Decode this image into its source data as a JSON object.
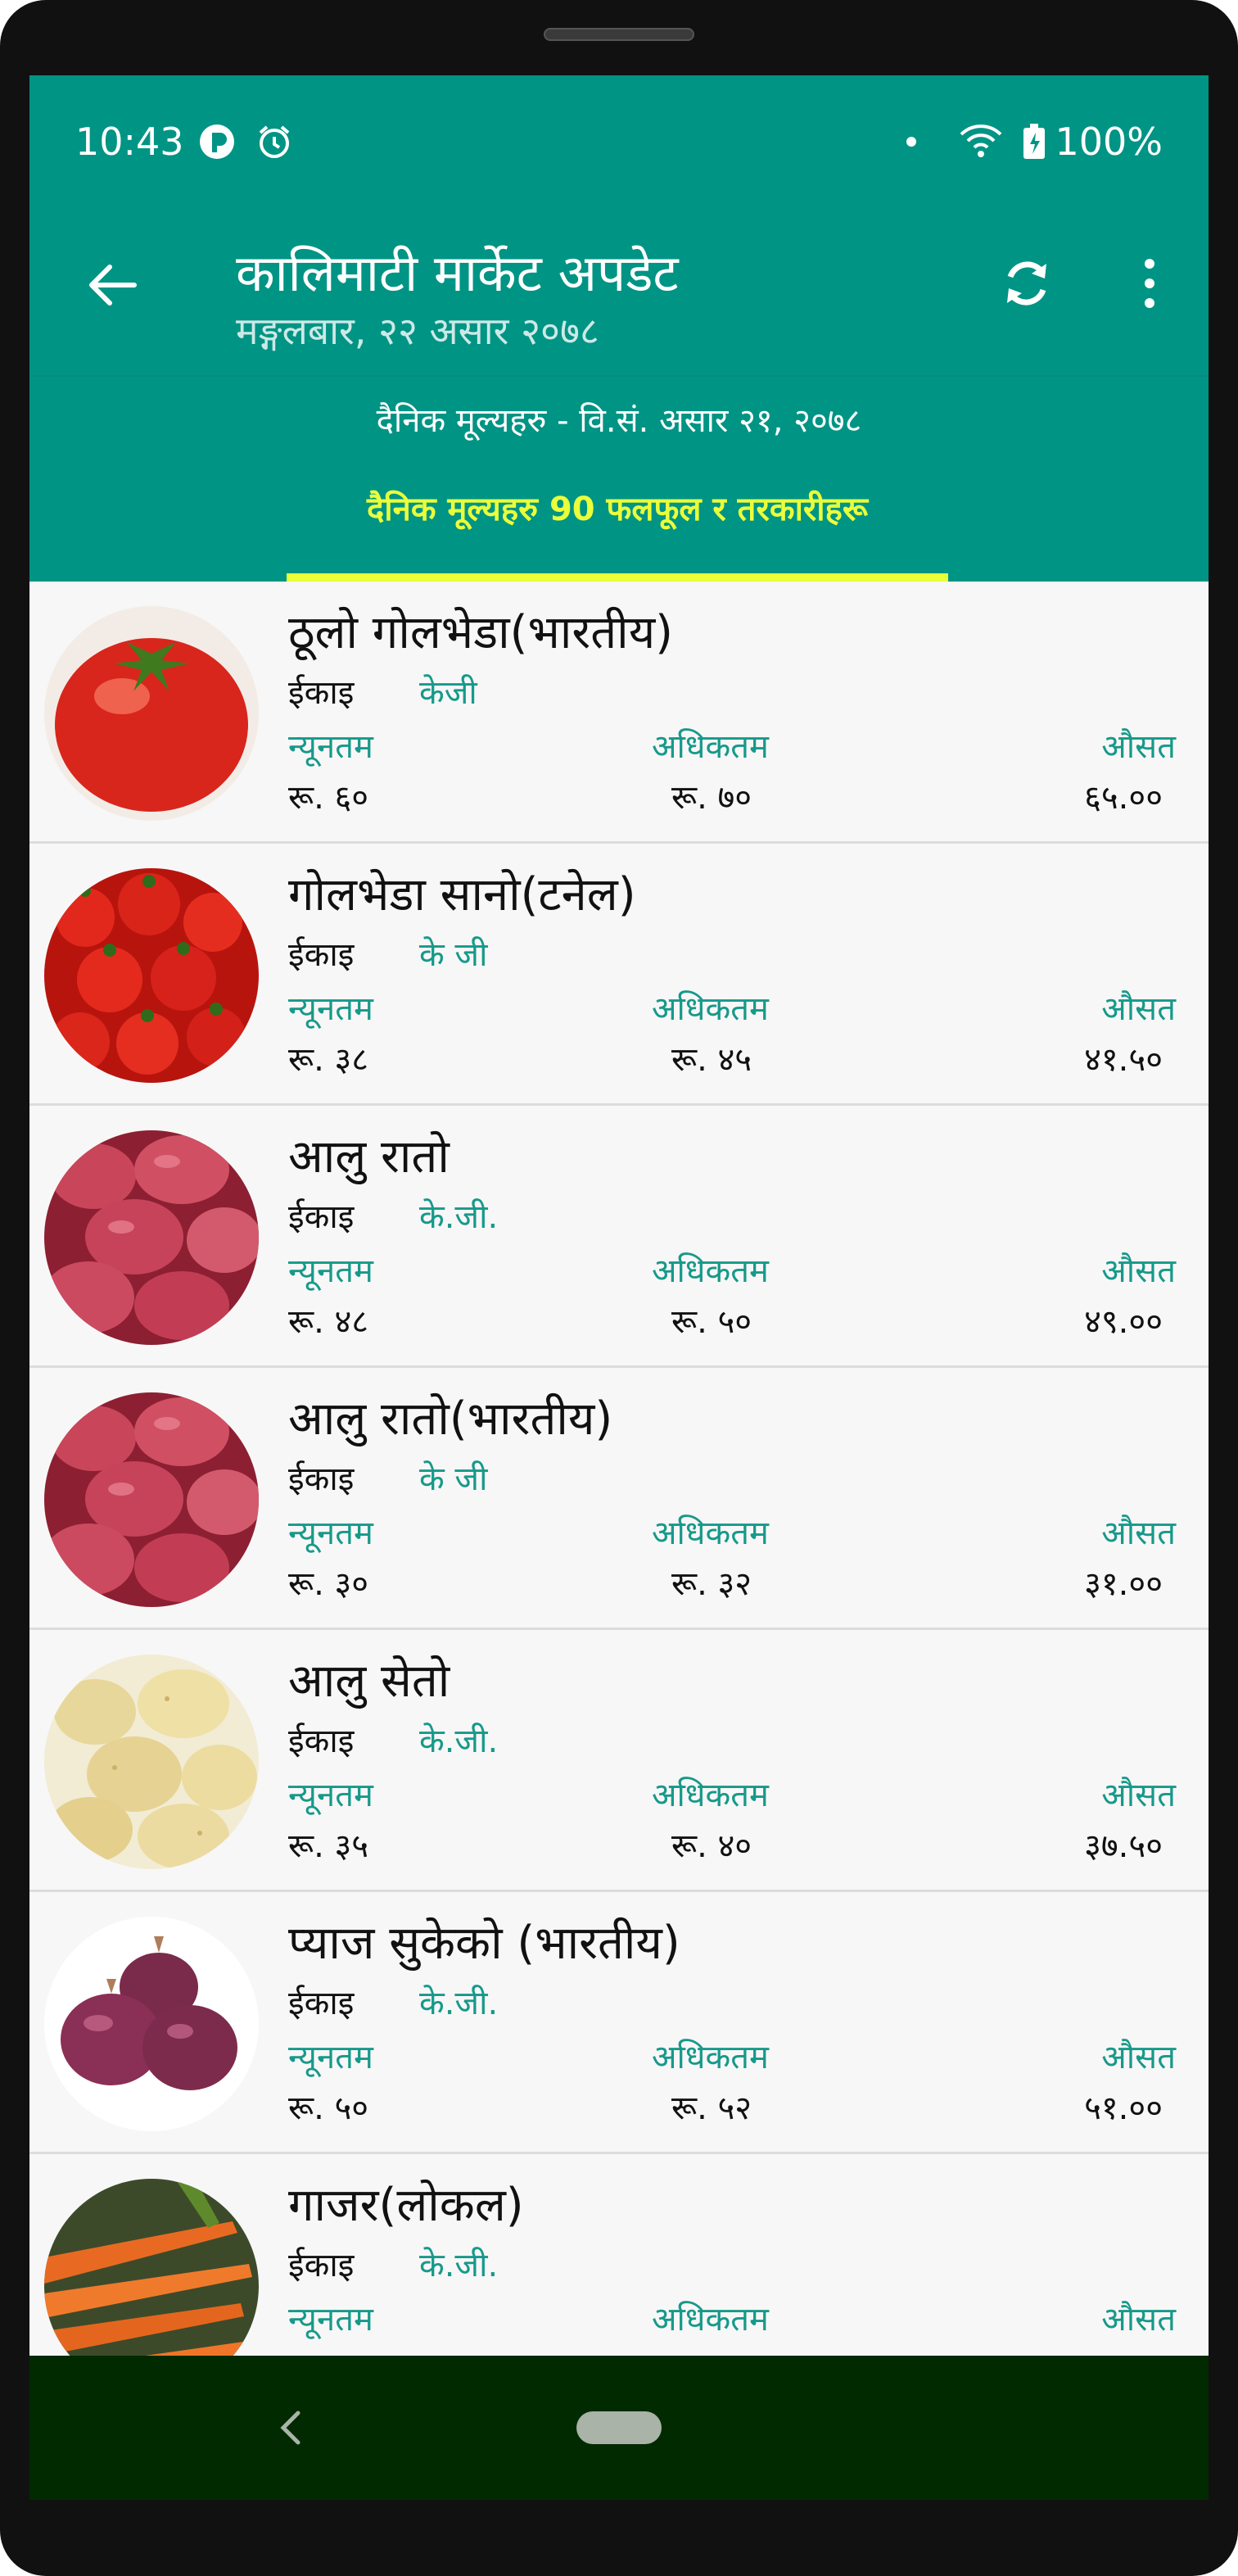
{
  "status_bar": {
    "time": "10:43",
    "battery": "100%"
  },
  "app_bar": {
    "title": "कालिमाटी मार्केट अपडेट",
    "subtitle": "मङ्गलबार, २२ असार २०७८"
  },
  "header": {
    "date_line": "दैनिक मूल्यहरु - वि.सं. असार २१, २०७८",
    "tab_label": "दैनिक मूल्यहरु 90 फलफूल र तरकारीहरू"
  },
  "labels": {
    "unit": "ईकाइ",
    "min": "न्यूनतम",
    "max": "अधिकतम",
    "avg": "औसत"
  },
  "items": [
    {
      "name": "ठूलो गोलभेडा(भारतीय)",
      "unit": "केजी",
      "min": "रू. ६०",
      "max": "रू. ७०",
      "avg": "६५.००",
      "image": "tomato-big"
    },
    {
      "name": "गोलभेडा सानो(टनेल)",
      "unit": "के जी",
      "min": "रू. ३८",
      "max": "रू. ४५",
      "avg": "४१.५०",
      "image": "tomato-small"
    },
    {
      "name": "आलु रातो",
      "unit": "के.जी.",
      "min": "रू. ४८",
      "max": "रू. ५०",
      "avg": "४९.००",
      "image": "potato-red"
    },
    {
      "name": "आलु रातो(भारतीय)",
      "unit": "के जी",
      "min": "रू. ३०",
      "max": "रू. ३२",
      "avg": "३१.००",
      "image": "potato-red"
    },
    {
      "name": "आलु सेतो",
      "unit": "के.जी.",
      "min": "रू. ३५",
      "max": "रू. ४०",
      "avg": "३७.५०",
      "image": "potato-white"
    },
    {
      "name": "प्याज सुकेको (भारतीय)",
      "unit": "के.जी.",
      "min": "रू. ५०",
      "max": "रू. ५२",
      "avg": "५१.००",
      "image": "onion"
    },
    {
      "name": "गाजर(लोकल)",
      "unit": "के.जी.",
      "min": "",
      "max": "",
      "avg": "",
      "image": "carrot"
    }
  ],
  "colors": {
    "primary": "#009485",
    "accent": "#eaff3a",
    "teal_text": "#17998a",
    "nav_bar": "#022a00"
  },
  "icons": [
    "back-arrow-icon",
    "refresh-icon",
    "more-vert-icon",
    "wifi-icon",
    "battery-icon",
    "alarm-icon"
  ]
}
